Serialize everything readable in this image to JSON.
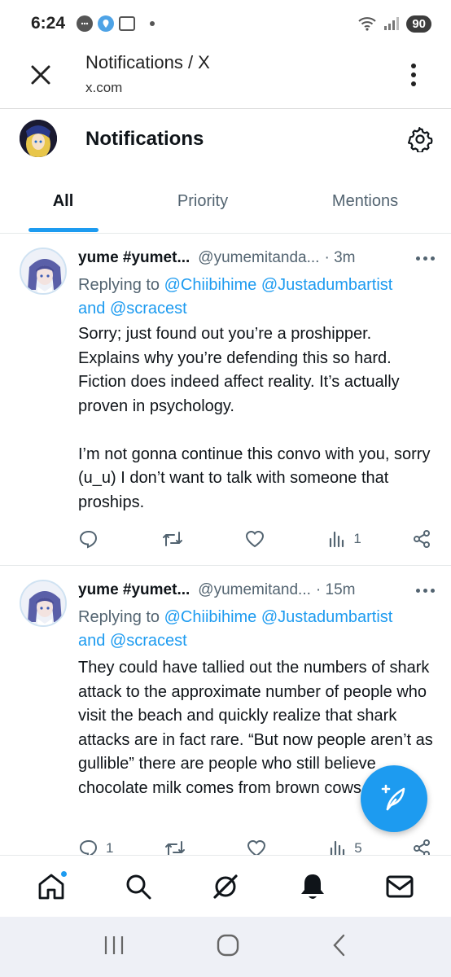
{
  "status_bar": {
    "time": "6:24",
    "battery": "90",
    "signal_label": "6"
  },
  "browser": {
    "title": "Notifications / X",
    "url": "x.com"
  },
  "header": {
    "title": "Notifications"
  },
  "tabs": [
    {
      "label": "All",
      "active": true
    },
    {
      "label": "Priority",
      "active": false
    },
    {
      "label": "Mentions",
      "active": false
    }
  ],
  "tweets": [
    {
      "name": "yume #yumet...",
      "handle": "@yumemitanda...",
      "time": "· 3m",
      "reply_prefix": "Replying to ",
      "mention_1": "@Chiibihime",
      "mention_2": "@Justadumbartist",
      "reply_and": "and ",
      "mention_3": "@scracest",
      "text": "Sorry; just found out you’re a proshipper. Explains why you’re defending this so hard. Fiction does indeed affect reality. It’s actually proven in psychology.\n\nI’m not gonna continue this convo with you, sorry (u_u) I don’t want to talk with someone that proships.",
      "replies": "",
      "views": "1"
    },
    {
      "name": "yume #yumet...",
      "handle": "@yumemitand...",
      "time": "· 15m",
      "reply_prefix": "Replying to ",
      "mention_1": "@Chiibihime",
      "mention_2": "@Justadumbartist",
      "reply_and": "and ",
      "mention_3": "@scracest",
      "text": "They could have tallied out the numbers of shark attack to the approximate number of people who visit the beach and quickly realize that shark attacks are in fact rare. “But now people aren’t as gullible” there are people who still believe chocolate milk comes from brown cows.",
      "replies": "1",
      "views": "5"
    }
  ],
  "icons": {
    "close": "close-icon",
    "menu": "more-vertical-icon",
    "settings": "gear-icon",
    "reply": "reply-icon",
    "retweet": "retweet-icon",
    "like": "heart-icon",
    "views": "views-icon",
    "share": "share-icon",
    "compose": "compose-icon"
  },
  "colors": {
    "accent": "#1d9bf0",
    "text_secondary": "#536471"
  }
}
